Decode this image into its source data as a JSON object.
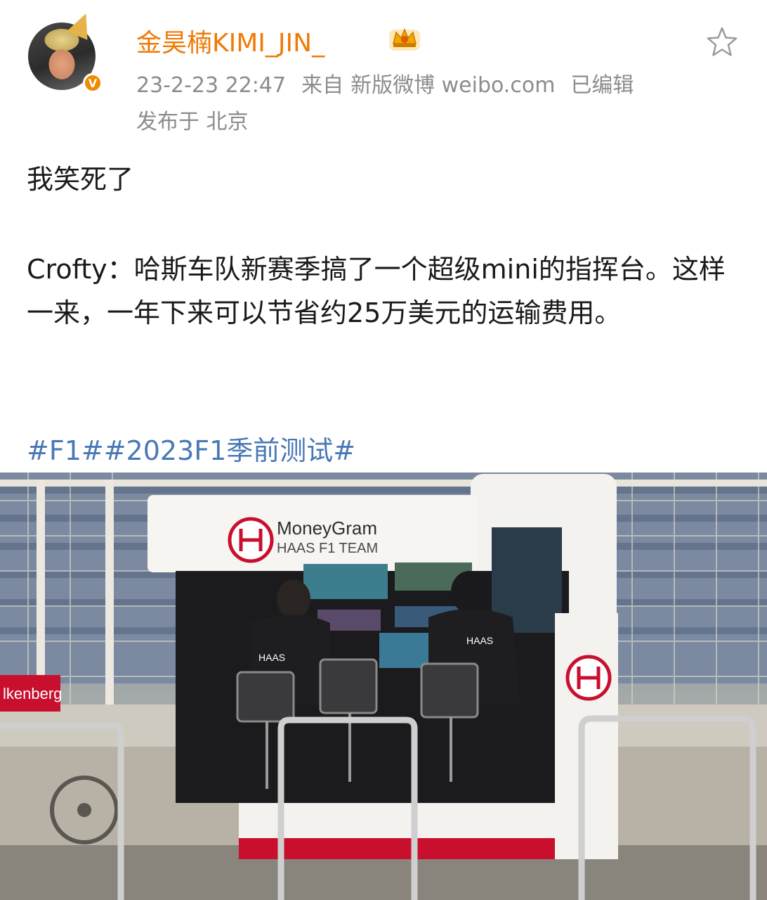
{
  "post": {
    "username": "金昊楠KIMI_JIN_",
    "timestamp": "23-2-23 22:47",
    "source_prefix": "来自",
    "source": "新版微博 weibo.com",
    "edited": "已编辑",
    "location": "发布于 北京",
    "text_line1": "我笑死了",
    "text_line2": "Crofty：哈斯车队新赛季搞了一个超级mini的指挥台。这样一来，一年下来可以节省约25万美元的运输费用。",
    "tags": [
      "#F1#",
      "#2023F1季前测试#"
    ],
    "verified_mark": "V"
  },
  "photo": {
    "sponsor": "MoneyGram",
    "team": "HAAS F1 TEAM",
    "shirt_logo": "HAAS",
    "sign_text": "lkenberg"
  },
  "colors": {
    "username": "#ef7a06",
    "meta": "#8c8c8c",
    "tag": "#4a78b6",
    "haas_red": "#c8102e"
  },
  "icons": {
    "favorite": "star-outline-icon",
    "badge": "crown-icon",
    "verified": "verified-icon"
  }
}
